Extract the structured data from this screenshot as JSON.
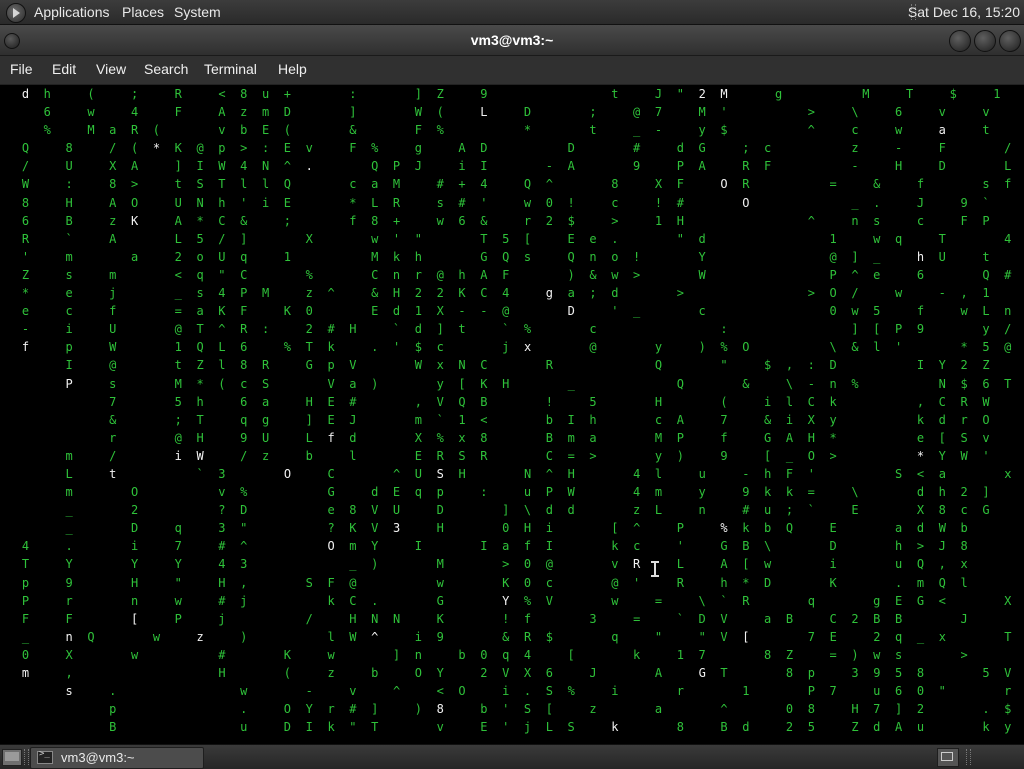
{
  "top_panel": {
    "menus": [
      "Applications",
      "Places",
      "System"
    ],
    "clock": "Sat Dec 16, 15:20"
  },
  "window": {
    "title": "vm3@vm3:~",
    "menus": [
      "File",
      "Edit",
      "View",
      "Search",
      "Terminal",
      "Help"
    ]
  },
  "terminal": {
    "program_output": "matrix-style falling characters",
    "colors": {
      "text": "#2fc23a",
      "highlight": "#f2f2f2",
      "background": "#000000"
    }
  },
  "taskbar": {
    "task_label": "vm3@vm3:~"
  }
}
